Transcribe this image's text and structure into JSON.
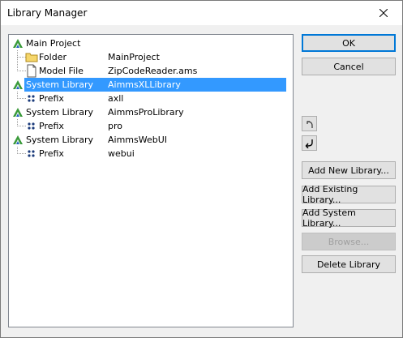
{
  "window": {
    "title": "Library Manager",
    "close_glyph": "✕"
  },
  "tree": {
    "rows": [
      {
        "name": "Main Project",
        "value": "",
        "icon": "aimms-logo-icon"
      },
      {
        "name": "Folder",
        "value": "MainProject",
        "icon": "folder-icon"
      },
      {
        "name": "Model File",
        "value": "ZipCodeReader.ams",
        "icon": "file-icon"
      },
      {
        "name": "System Library",
        "value": "AimmsXLLibrary",
        "icon": "aimms-logo-icon"
      },
      {
        "name": "Prefix",
        "value": "axll",
        "icon": "prefix-dots-icon"
      },
      {
        "name": "System Library",
        "value": "AimmsProLibrary",
        "icon": "aimms-logo-icon"
      },
      {
        "name": "Prefix",
        "value": "pro",
        "icon": "prefix-dots-icon"
      },
      {
        "name": "System Library",
        "value": "AimmsWebUI",
        "icon": "aimms-logo-icon"
      },
      {
        "name": "Prefix",
        "value": "webui",
        "icon": "prefix-dots-icon"
      }
    ],
    "selected_index": 3
  },
  "buttons": {
    "ok": "OK",
    "cancel": "Cancel",
    "move_up_icon": "move-up-icon",
    "move_down_icon": "move-down-icon",
    "add_new": "Add New Library...",
    "add_existing": "Add Existing Library...",
    "add_system": "Add System Library...",
    "browse": "Browse...",
    "delete": "Delete Library"
  },
  "colors": {
    "selection": "#3399ff",
    "default_button_border": "#0078d7",
    "logo_green": "#3a9a3a",
    "logo_blue": "#2060c0",
    "folder_yellow": "#f5d66b"
  }
}
